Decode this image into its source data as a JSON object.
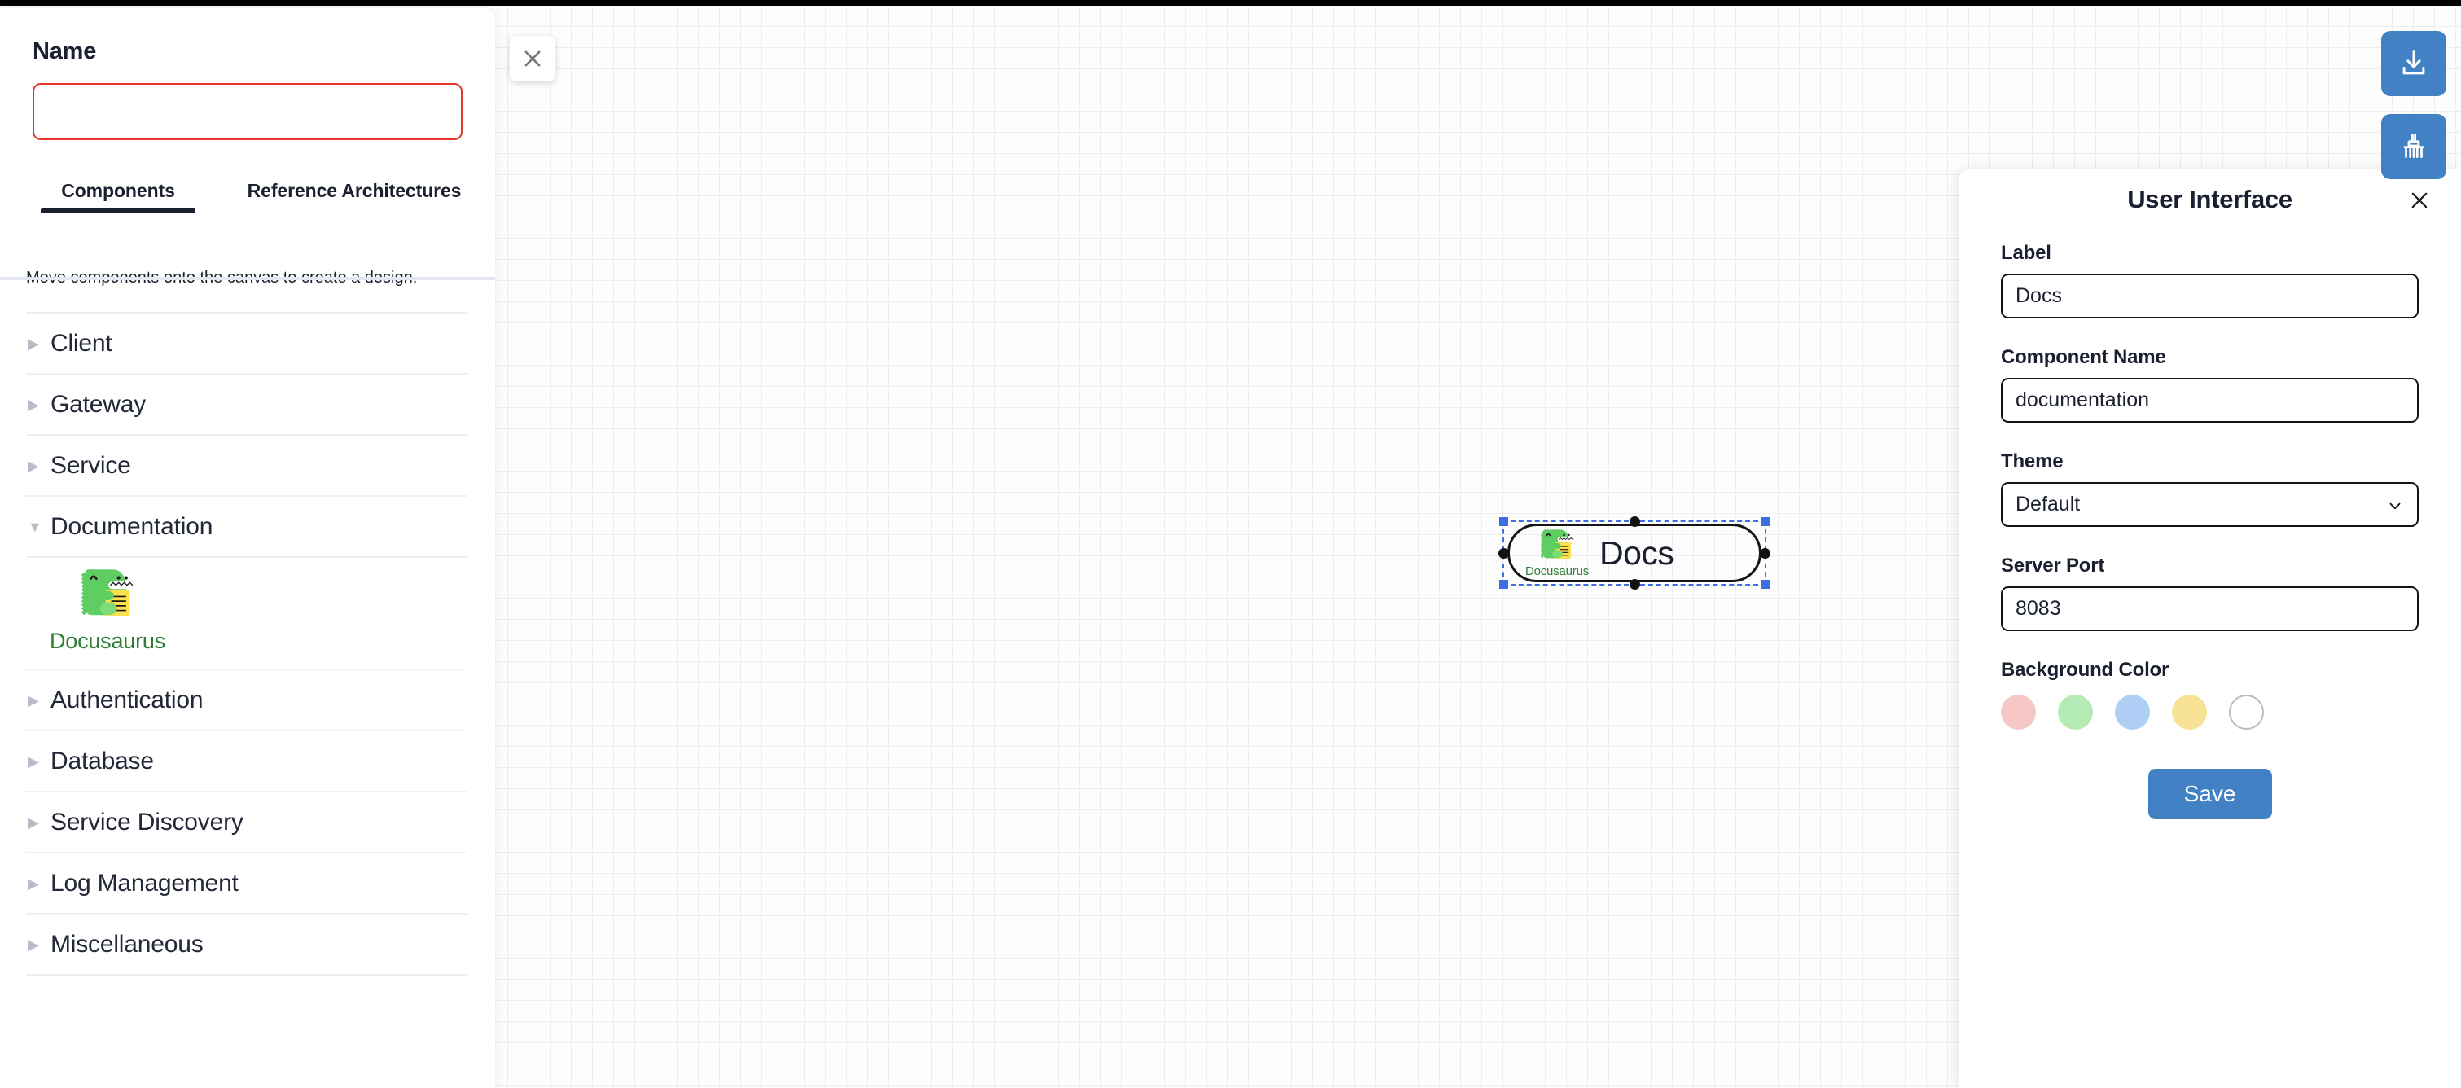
{
  "left_panel": {
    "name_label": "Name",
    "name_value": "",
    "name_placeholder": "",
    "tabs": [
      {
        "label": "Components",
        "active": true
      },
      {
        "label": "Reference Architectures",
        "active": false
      }
    ],
    "hint": "Move components onto the canvas to create a design.",
    "groups": [
      {
        "label": "Client",
        "expanded": false,
        "caret": "▶"
      },
      {
        "label": "Gateway",
        "expanded": false,
        "caret": "▶"
      },
      {
        "label": "Service",
        "expanded": false,
        "caret": "▶"
      },
      {
        "label": "Documentation",
        "expanded": true,
        "caret": "▼"
      },
      {
        "label": "Authentication",
        "expanded": false,
        "caret": "▶"
      },
      {
        "label": "Database",
        "expanded": false,
        "caret": "▶"
      },
      {
        "label": "Service Discovery",
        "expanded": false,
        "caret": "▶"
      },
      {
        "label": "Log Management",
        "expanded": false,
        "caret": "▶"
      },
      {
        "label": "Miscellaneous",
        "expanded": false,
        "caret": "▶"
      }
    ],
    "documentation_items": [
      {
        "label": "Docusaurus",
        "icon": "docusaurus-logo-icon"
      }
    ]
  },
  "canvas": {
    "close_icon": "close-icon",
    "node": {
      "title": "Docs",
      "icon": "docusaurus-logo-icon",
      "icon_caption": "Docusaurus",
      "selected": true
    }
  },
  "toolbar": {
    "buttons": [
      {
        "name": "download-icon",
        "title": "Download"
      },
      {
        "name": "broom-clear-icon",
        "title": "Clear canvas"
      }
    ],
    "accent_color": "#4282c4"
  },
  "properties_panel": {
    "title": "User Interface",
    "close_icon": "close-icon",
    "fields": {
      "label": {
        "label": "Label",
        "value": "Docs"
      },
      "component_name": {
        "label": "Component Name",
        "value": "documentation"
      },
      "theme": {
        "label": "Theme",
        "value": "Default",
        "options": [
          "Default"
        ]
      },
      "server_port": {
        "label": "Server Port",
        "value": "8083"
      },
      "background_color": {
        "label": "Background Color"
      }
    },
    "swatches": [
      {
        "name": "swatch-pink",
        "color": "#f7c7c7",
        "selected": false
      },
      {
        "name": "swatch-green",
        "color": "#b4ebb4",
        "selected": false
      },
      {
        "name": "swatch-blue",
        "color": "#aecef5",
        "selected": false
      },
      {
        "name": "swatch-yellow",
        "color": "#f8e296",
        "selected": false
      },
      {
        "name": "swatch-white",
        "color": "#ffffff",
        "selected": false
      }
    ],
    "save_label": "Save"
  }
}
